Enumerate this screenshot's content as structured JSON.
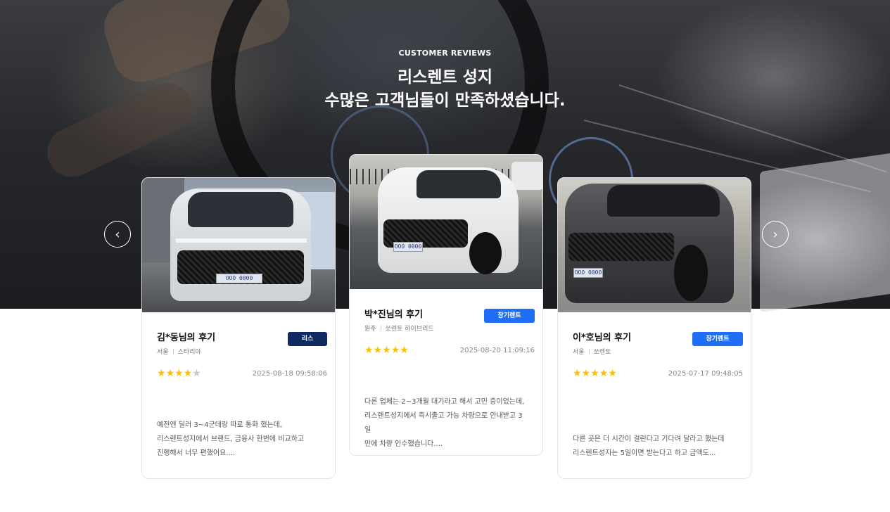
{
  "section": {
    "eyebrow": "CUSTOMER REVIEWS",
    "title_line1": "리스렌트 성지",
    "title_line2": "수많은 고객님들이 만족하셨습니다."
  },
  "nav": {
    "prev_icon": "‹",
    "next_icon": "›"
  },
  "colors": {
    "lease_badge": "#0d2a63",
    "rent_badge": "#1f6ef5",
    "star": "#f7c200"
  },
  "reviews": [
    {
      "name": "김*동님의 후기",
      "region": "서울",
      "model": "스타리아",
      "badge": "리스",
      "rating": 4,
      "date": "2025-08-18 09:58:06",
      "text_line1": "예전엔 딜러 3~4군데랑 따로 통화 했는데,",
      "text_line2": "리스렌트성지에서 브랜드, 금융사 한번에 비교하고",
      "text_line3": "진행해서 너무 편했어요...."
    },
    {
      "name": "박*진님의 후기",
      "region": "원주",
      "model": "쏘렌토 하이브리드",
      "badge": "장기렌트",
      "rating": 5,
      "date": "2025-08-20 11:09:16",
      "text_line1": "다른 업체는 2~3개월 대기라고 해서 고민 중이었는데,",
      "text_line2": "리스렌트성지에서 즉시출고 가능 차량으로 안내받고 3일",
      "text_line3": "만에 차량 인수했습니다...."
    },
    {
      "name": "이*호님의 후기",
      "region": "서울",
      "model": "쏘렌토",
      "badge": "장기렌트",
      "rating": 5,
      "date": "2025-07-17 09:48:05",
      "text_line1": "다른 곳은 더 시간이 걸린다고 기다려 달라고 했는데",
      "text_line2": "리스렌트성지는 5일이면 받는다고 하고 금액도..."
    }
  ],
  "plates": [
    "OOO 0000",
    "OOO 0000",
    "OOO 0000"
  ]
}
